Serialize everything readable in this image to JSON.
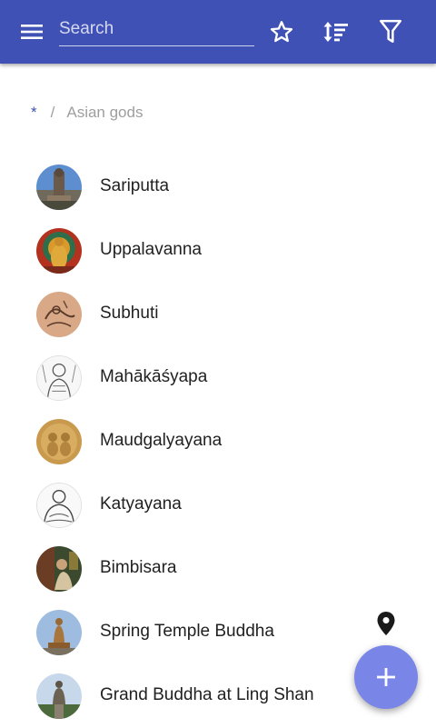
{
  "toolbar": {
    "menu_icon": "menu-icon",
    "search_placeholder": "Search",
    "search_value": "",
    "favorite_icon": "star-outline-icon",
    "sort_icon": "sort-icon",
    "filter_icon": "filter-icon",
    "color": "#3f51b5"
  },
  "breadcrumb": {
    "root": "*",
    "separator": "/",
    "current": "Asian gods"
  },
  "items": [
    {
      "label": "Sariputta",
      "avatar": "statue-photo"
    },
    {
      "label": "Uppalavanna",
      "avatar": "painting-thumbnail"
    },
    {
      "label": "Subhuti",
      "avatar": "sketch-thumbnail"
    },
    {
      "label": "Mahākāśyapa",
      "avatar": "line-drawing-thumbnail"
    },
    {
      "label": "Maudgalyayana",
      "avatar": "carving-thumbnail"
    },
    {
      "label": "Katyayana",
      "avatar": "line-drawing-thumbnail"
    },
    {
      "label": "Bimbisara",
      "avatar": "painting-thumbnail"
    },
    {
      "label": "Spring Temple Buddha",
      "avatar": "statue-photo",
      "location_icon": "map-pin-icon"
    },
    {
      "label": "Grand Buddha at Ling Shan",
      "avatar": "statue-photo"
    }
  ],
  "fab": {
    "icon": "plus-icon",
    "color": "#7986e8"
  }
}
